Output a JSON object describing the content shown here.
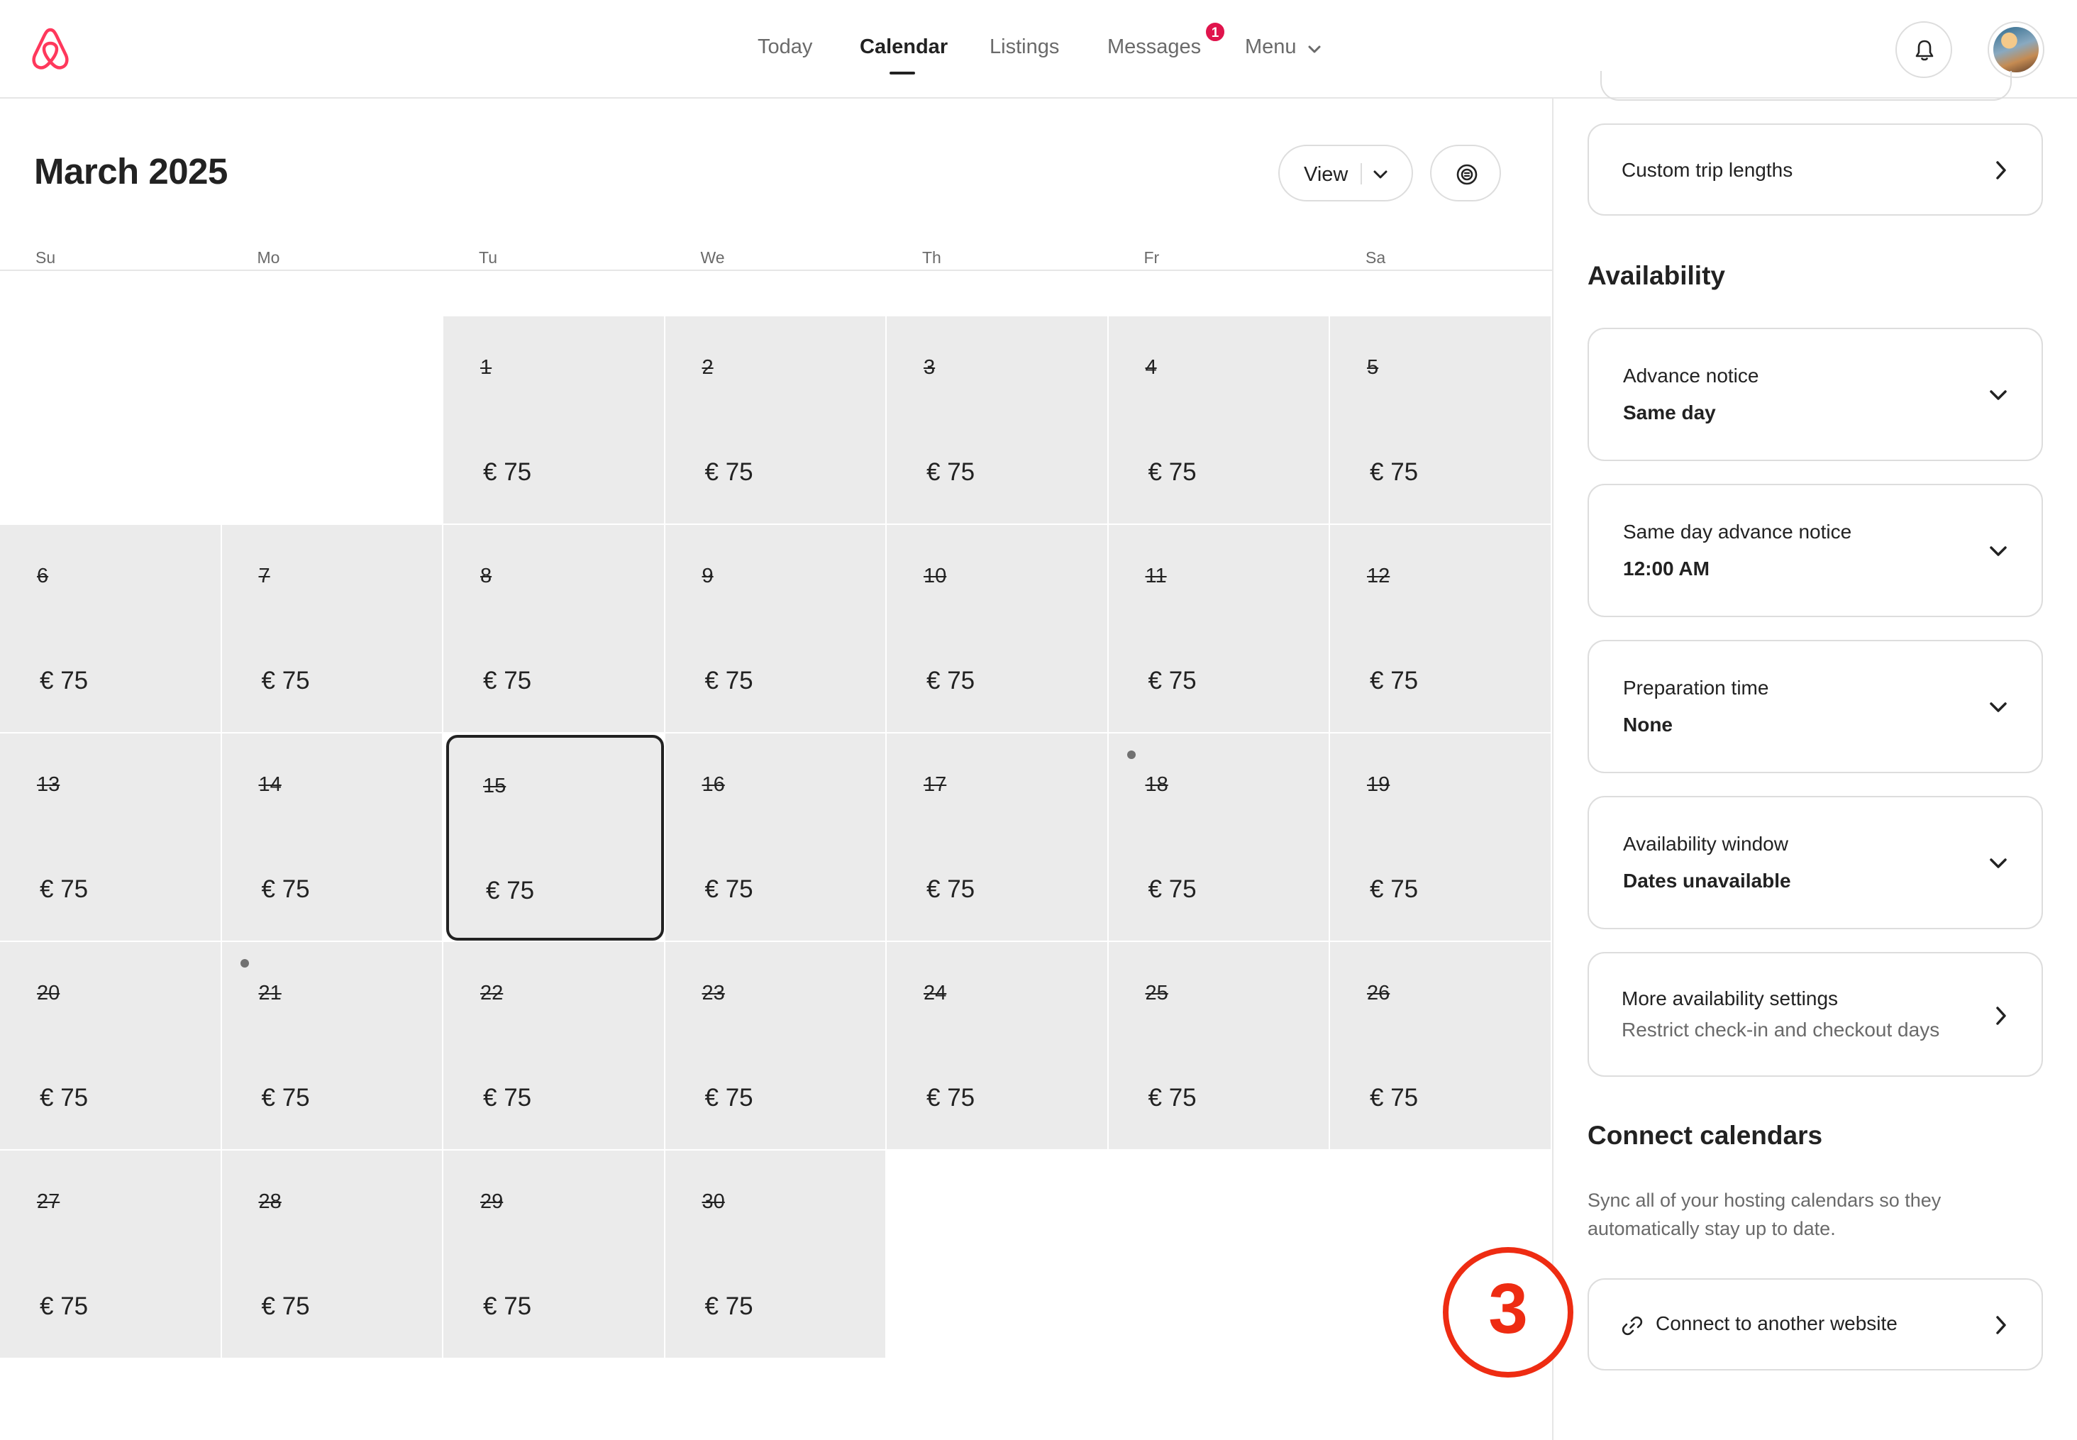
{
  "header": {
    "nav": [
      {
        "label": "Today",
        "active": false
      },
      {
        "label": "Calendar",
        "active": true
      },
      {
        "label": "Listings",
        "active": false
      },
      {
        "label": "Messages",
        "active": false
      },
      {
        "label": "Menu",
        "active": false
      }
    ],
    "messages_badge": "1",
    "brand_color": "#FF385C",
    "badge_color": "#E0144C"
  },
  "calendar": {
    "month_title": "March 2025",
    "view_label": "View",
    "weekdays": [
      "Su",
      "Mo",
      "Tu",
      "We",
      "Th",
      "Fr",
      "Sa"
    ],
    "days": [
      {
        "day": "1",
        "price": "€ 75"
      },
      {
        "day": "2",
        "price": "€ 75"
      },
      {
        "day": "3",
        "price": "€ 75"
      },
      {
        "day": "4",
        "price": "€ 75"
      },
      {
        "day": "5",
        "price": "€ 75"
      },
      {
        "day": "6",
        "price": "€ 75"
      },
      {
        "day": "7",
        "price": "€ 75"
      },
      {
        "day": "8",
        "price": "€ 75"
      },
      {
        "day": "9",
        "price": "€ 75"
      },
      {
        "day": "10",
        "price": "€ 75"
      },
      {
        "day": "11",
        "price": "€ 75"
      },
      {
        "day": "12",
        "price": "€ 75"
      },
      {
        "day": "13",
        "price": "€ 75"
      },
      {
        "day": "14",
        "price": "€ 75"
      },
      {
        "day": "15",
        "price": "€ 75",
        "selected": true
      },
      {
        "day": "16",
        "price": "€ 75"
      },
      {
        "day": "17",
        "price": "€ 75"
      },
      {
        "day": "18",
        "price": "€ 75",
        "dot": true
      },
      {
        "day": "19",
        "price": "€ 75"
      },
      {
        "day": "20",
        "price": "€ 75"
      },
      {
        "day": "21",
        "price": "€ 75",
        "dot": true
      },
      {
        "day": "22",
        "price": "€ 75"
      },
      {
        "day": "23",
        "price": "€ 75"
      },
      {
        "day": "24",
        "price": "€ 75"
      },
      {
        "day": "25",
        "price": "€ 75"
      },
      {
        "day": "26",
        "price": "€ 75"
      },
      {
        "day": "27",
        "price": "€ 75"
      },
      {
        "day": "28",
        "price": "€ 75"
      },
      {
        "day": "29",
        "price": "€ 75"
      },
      {
        "day": "30",
        "price": "€ 75"
      }
    ],
    "days_struck_through": true
  },
  "sidebar": {
    "custom_trip_lengths": "Custom trip lengths",
    "availability_title": "Availability",
    "availability_cards": [
      {
        "title": "Advance notice",
        "value": "Same day"
      },
      {
        "title": "Same day advance notice",
        "value": "12:00 AM"
      },
      {
        "title": "Preparation time",
        "value": "None"
      },
      {
        "title": "Availability window",
        "value": "Dates unavailable"
      }
    ],
    "more_settings": {
      "title": "More availability settings",
      "subtitle": "Restrict check-in and checkout days"
    },
    "connect_title": "Connect calendars",
    "connect_desc": "Sync all of your hosting calendars so they automatically stay up to date.",
    "connect_link": "Connect to another website"
  },
  "annotation": {
    "step_number": "3",
    "color": "#EE2C12"
  }
}
